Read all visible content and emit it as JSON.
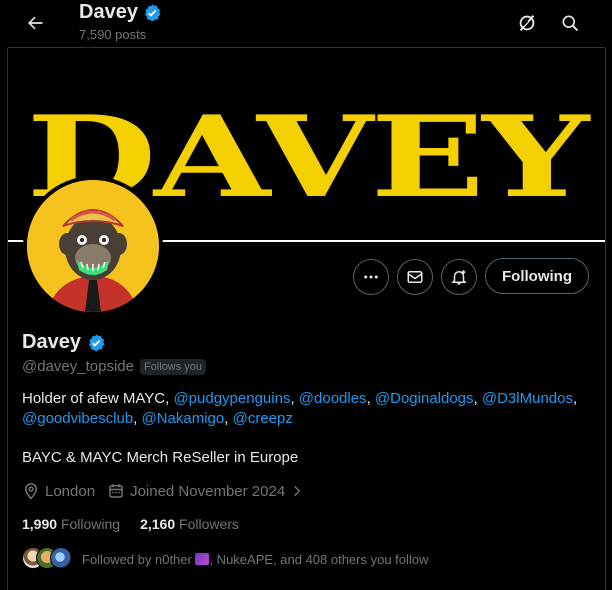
{
  "header": {
    "name": "Davey",
    "posts": "7,590 posts"
  },
  "banner": {
    "text": "DAVEY"
  },
  "actions": {
    "following_label": "Following"
  },
  "profile": {
    "name": "Davey",
    "handle": "@davey_topside",
    "follows_you": "Follows you",
    "bio_intro": "Holder of afew MAYC, ",
    "bio_mentions": [
      "@pudgypenguins",
      "@doodles",
      "@Doginaldogs",
      "@D3lMundos",
      "@goodvibesclub",
      "@Nakamigo",
      "@creepz"
    ],
    "bio_line2": "BAYC & MAYC Merch ReSeller in Europe",
    "location": "London",
    "joined": "Joined November 2024"
  },
  "stats": {
    "following_count": "1,990",
    "following_label": "Following",
    "followers_count": "2,160",
    "followers_label": "Followers"
  },
  "followed_by": {
    "text_before": "Followed by n0ther ",
    "text_after": ", NukeAPE, and 408 others you follow"
  },
  "colors": {
    "accent": "#1d9bf0",
    "banner_yellow": "#f5d000",
    "verified": "#1d9bf0"
  },
  "icons": [
    "back-arrow-icon",
    "verified-icon",
    "grok-icon",
    "search-icon",
    "more-icon",
    "message-icon",
    "notify-icon",
    "location-icon",
    "calendar-icon",
    "chevron-right-icon"
  ]
}
